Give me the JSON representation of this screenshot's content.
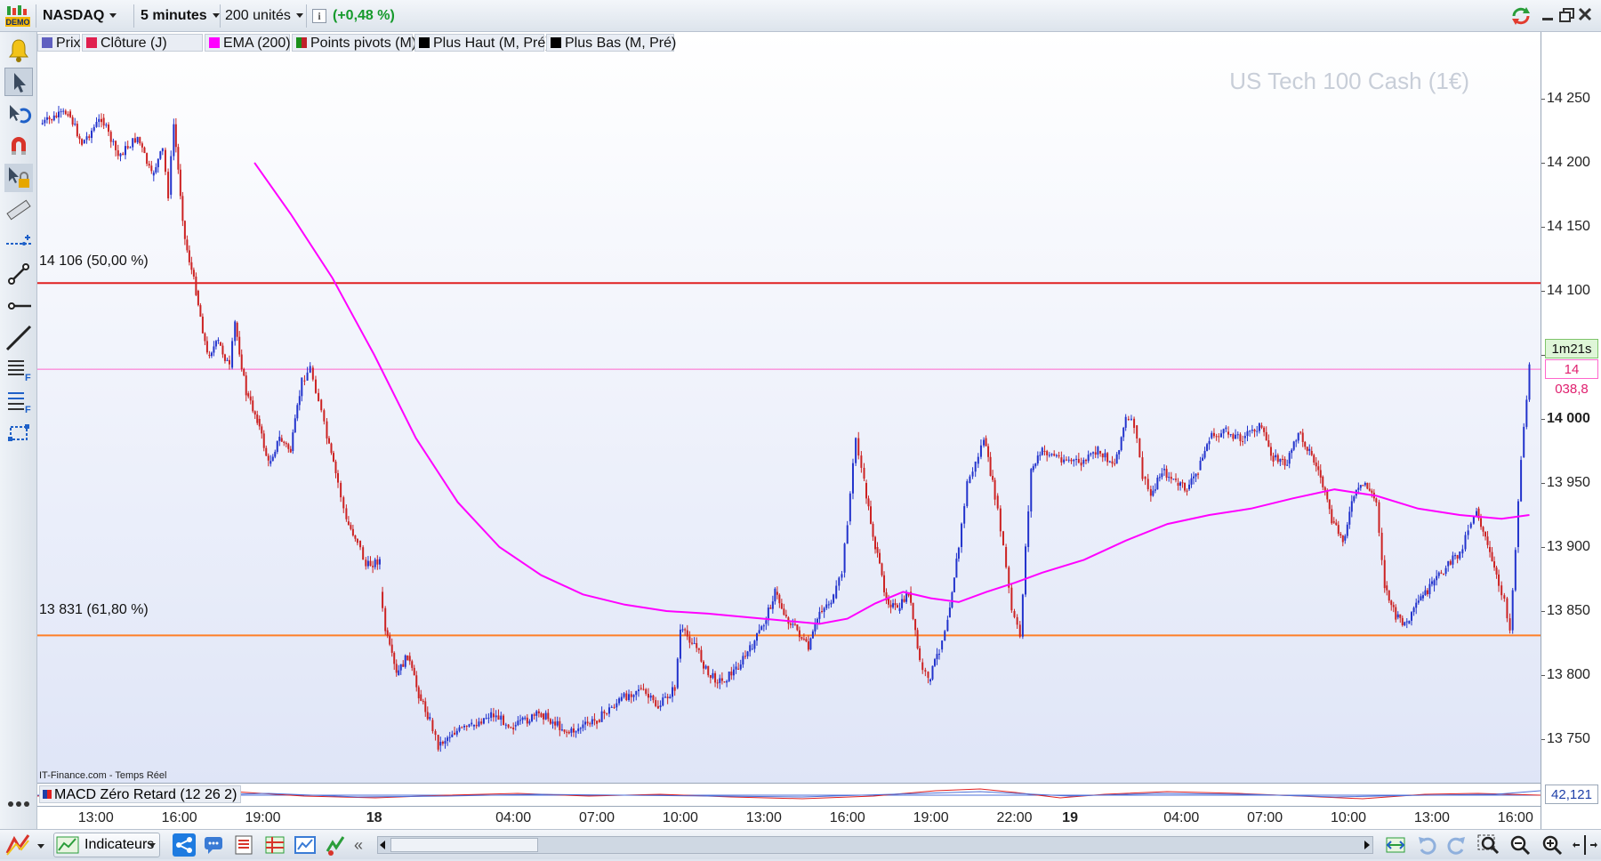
{
  "toolbar": {
    "symbol": "NASDAQ",
    "timeframe": "5 minutes",
    "units": "200 unités",
    "change": "(+0,48 %)",
    "info_icon": "info-icon",
    "demo_badge": "DEMO"
  },
  "legend": [
    {
      "label": "Prix",
      "color": "#6060c0"
    },
    {
      "label": "Clôture (J)",
      "color": "#e0204f"
    },
    {
      "label": "EMA (200)",
      "color": "#ff00ff"
    },
    {
      "label": "Points pivots (M)",
      "color": "#1a8f1a"
    },
    {
      "label": "Plus Haut (M, Pré)",
      "color": "#000000"
    },
    {
      "label": "Plus Bas (M, Pré)",
      "color": "#000000"
    }
  ],
  "watermark": "US Tech 100 Cash (1€)",
  "source_note": "IT-Finance.com - Temps Réel",
  "levels": [
    {
      "label": "14 106 (50,00 %)",
      "value": 14106,
      "color": "#e02020"
    },
    {
      "label": "13 831 (61,80 %)",
      "value": 13831,
      "color": "#ff7f27"
    }
  ],
  "current": {
    "timer": "1m21s",
    "price_label": "14 038,8",
    "value": 14038.8,
    "color": "#ff66cc"
  },
  "macd": {
    "label": "MACD Zéro Retard (12 26 2)",
    "value": "42,121"
  },
  "chart_data": {
    "type": "candlestick",
    "y_ticks": [
      "14 250",
      "14 200",
      "14 150",
      "14 100",
      "14 050",
      "14 000",
      "13 950",
      "13 900",
      "13 850",
      "13 800",
      "13 750"
    ],
    "y_tick_values": [
      14250,
      14200,
      14150,
      14100,
      14050,
      14000,
      13950,
      13900,
      13850,
      13800,
      13750
    ],
    "ylim": [
      13716,
      14302
    ],
    "x_ticks": [
      {
        "label": "13:00",
        "t": 1,
        "bold": false
      },
      {
        "label": "16:00",
        "t": 4,
        "bold": false
      },
      {
        "label": "19:00",
        "t": 7,
        "bold": false
      },
      {
        "label": "18",
        "t": 11,
        "bold": true
      },
      {
        "label": "04:00",
        "t": 16,
        "bold": false
      },
      {
        "label": "07:00",
        "t": 19,
        "bold": false
      },
      {
        "label": "10:00",
        "t": 22,
        "bold": false
      },
      {
        "label": "13:00",
        "t": 25,
        "bold": false
      },
      {
        "label": "16:00",
        "t": 28,
        "bold": false
      },
      {
        "label": "19:00",
        "t": 31,
        "bold": false
      },
      {
        "label": "22:00",
        "t": 34,
        "bold": false
      },
      {
        "label": "19",
        "t": 36,
        "bold": true
      },
      {
        "label": "04:00",
        "t": 40,
        "bold": false
      },
      {
        "label": "07:00",
        "t": 43,
        "bold": false
      },
      {
        "label": "10:00",
        "t": 46,
        "bold": false
      },
      {
        "label": "13:00",
        "t": 49,
        "bold": false
      },
      {
        "label": "16:00",
        "t": 52,
        "bold": false
      }
    ],
    "xlim": [
      -1.1,
      52.9
    ],
    "price_path": [
      [
        -1.0,
        14230
      ],
      [
        0.0,
        14240
      ],
      [
        0.5,
        14215
      ],
      [
        1.2,
        14235
      ],
      [
        1.8,
        14205
      ],
      [
        2.5,
        14220
      ],
      [
        3.0,
        14190
      ],
      [
        3.4,
        14210
      ],
      [
        3.6,
        14175
      ],
      [
        3.8,
        14230
      ],
      [
        4.2,
        14140
      ],
      [
        4.6,
        14100
      ],
      [
        5.0,
        14050
      ],
      [
        5.4,
        14060
      ],
      [
        5.8,
        14040
      ],
      [
        6.0,
        14075
      ],
      [
        6.4,
        14020
      ],
      [
        6.8,
        14000
      ],
      [
        7.2,
        13965
      ],
      [
        7.6,
        13985
      ],
      [
        8.0,
        13975
      ],
      [
        8.4,
        14030
      ],
      [
        8.7,
        14040
      ],
      [
        9.0,
        14015
      ],
      [
        9.3,
        13985
      ],
      [
        9.7,
        13950
      ],
      [
        10.0,
        13920
      ],
      [
        10.4,
        13905
      ],
      [
        10.7,
        13885
      ],
      [
        11.2,
        13890
      ],
      [
        11.2,
        13865
      ],
      [
        11.4,
        13835
      ],
      [
        11.8,
        13800
      ],
      [
        12.2,
        13815
      ],
      [
        12.6,
        13785
      ],
      [
        13.0,
        13765
      ],
      [
        13.3,
        13745
      ],
      [
        13.8,
        13755
      ],
      [
        14.5,
        13760
      ],
      [
        15.2,
        13770
      ],
      [
        16.0,
        13760
      ],
      [
        17.0,
        13770
      ],
      [
        18.0,
        13755
      ],
      [
        19.0,
        13765
      ],
      [
        19.8,
        13780
      ],
      [
        20.5,
        13790
      ],
      [
        21.2,
        13775
      ],
      [
        21.8,
        13790
      ],
      [
        22.0,
        13835
      ],
      [
        22.5,
        13825
      ],
      [
        23.0,
        13800
      ],
      [
        23.5,
        13795
      ],
      [
        24.0,
        13805
      ],
      [
        24.5,
        13820
      ],
      [
        25.0,
        13840
      ],
      [
        25.4,
        13865
      ],
      [
        25.8,
        13845
      ],
      [
        26.2,
        13835
      ],
      [
        26.6,
        13820
      ],
      [
        27.0,
        13850
      ],
      [
        27.5,
        13860
      ],
      [
        27.8,
        13880
      ],
      [
        28.0,
        13920
      ],
      [
        28.3,
        13985
      ],
      [
        28.6,
        13950
      ],
      [
        29.0,
        13900
      ],
      [
        29.4,
        13860
      ],
      [
        29.8,
        13850
      ],
      [
        30.2,
        13865
      ],
      [
        30.6,
        13810
      ],
      [
        30.9,
        13795
      ],
      [
        31.3,
        13820
      ],
      [
        31.6,
        13845
      ],
      [
        32.0,
        13900
      ],
      [
        32.3,
        13950
      ],
      [
        32.6,
        13965
      ],
      [
        32.9,
        13985
      ],
      [
        33.3,
        13940
      ],
      [
        33.6,
        13900
      ],
      [
        33.9,
        13850
      ],
      [
        34.2,
        13830
      ],
      [
        34.4,
        13900
      ],
      [
        34.6,
        13960
      ],
      [
        35.0,
        13975
      ],
      [
        35.6,
        13970
      ],
      [
        36.4,
        13965
      ],
      [
        37.0,
        13975
      ],
      [
        37.6,
        13965
      ],
      [
        38.0,
        14000
      ],
      [
        38.3,
        13995
      ],
      [
        38.6,
        13955
      ],
      [
        38.9,
        13940
      ],
      [
        39.3,
        13960
      ],
      [
        39.8,
        13950
      ],
      [
        40.2,
        13945
      ],
      [
        40.6,
        13960
      ],
      [
        41.0,
        13985
      ],
      [
        41.6,
        13990
      ],
      [
        42.2,
        13985
      ],
      [
        42.8,
        13995
      ],
      [
        43.3,
        13970
      ],
      [
        43.8,
        13965
      ],
      [
        44.2,
        13990
      ],
      [
        44.6,
        13975
      ],
      [
        45.0,
        13955
      ],
      [
        45.4,
        13920
      ],
      [
        45.8,
        13905
      ],
      [
        46.2,
        13940
      ],
      [
        46.6,
        13950
      ],
      [
        47.0,
        13935
      ],
      [
        47.3,
        13870
      ],
      [
        47.7,
        13845
      ],
      [
        48.1,
        13840
      ],
      [
        48.6,
        13860
      ],
      [
        49.0,
        13870
      ],
      [
        49.5,
        13885
      ],
      [
        50.0,
        13895
      ],
      [
        50.3,
        13915
      ],
      [
        50.6,
        13930
      ],
      [
        51.0,
        13900
      ],
      [
        51.4,
        13870
      ],
      [
        51.6,
        13860
      ],
      [
        51.8,
        13835
      ],
      [
        52.0,
        13900
      ],
      [
        52.2,
        13970
      ],
      [
        52.5,
        14040
      ]
    ],
    "ema_200": [
      [
        6.7,
        14200
      ],
      [
        8.0,
        14160
      ],
      [
        9.5,
        14110
      ],
      [
        11.0,
        14050
      ],
      [
        12.5,
        13985
      ],
      [
        14.0,
        13935
      ],
      [
        15.5,
        13900
      ],
      [
        17.0,
        13878
      ],
      [
        18.5,
        13863
      ],
      [
        20.0,
        13855
      ],
      [
        21.5,
        13850
      ],
      [
        23.0,
        13848
      ],
      [
        24.5,
        13845
      ],
      [
        26.0,
        13842
      ],
      [
        27.0,
        13840
      ],
      [
        28.0,
        13844
      ],
      [
        29.0,
        13856
      ],
      [
        30.0,
        13865
      ],
      [
        31.0,
        13860
      ],
      [
        32.0,
        13857
      ],
      [
        33.0,
        13865
      ],
      [
        34.0,
        13872
      ],
      [
        35.0,
        13880
      ],
      [
        36.5,
        13890
      ],
      [
        38.0,
        13905
      ],
      [
        39.5,
        13918
      ],
      [
        41.0,
        13925
      ],
      [
        42.5,
        13930
      ],
      [
        44.0,
        13938
      ],
      [
        45.5,
        13945
      ],
      [
        47.0,
        13940
      ],
      [
        48.5,
        13930
      ],
      [
        50.0,
        13925
      ],
      [
        51.5,
        13922
      ],
      [
        52.5,
        13925
      ]
    ]
  },
  "bottom": {
    "indicators_label": "Indicateurs"
  }
}
